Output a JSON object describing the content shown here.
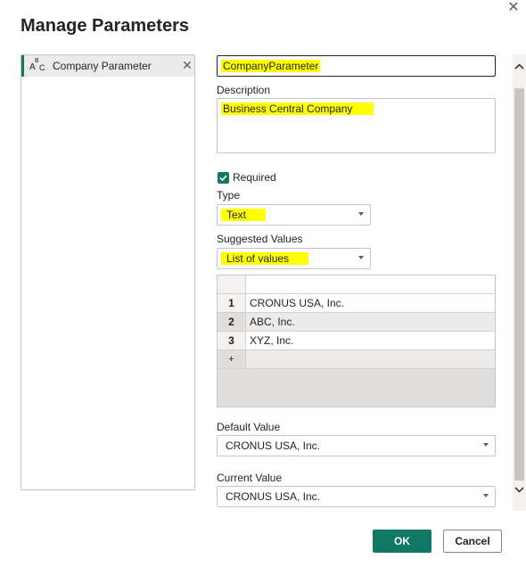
{
  "dialog": {
    "title": "Manage Parameters",
    "close_glyph": "✕"
  },
  "parameter_list": {
    "items": [
      {
        "type_icon": "abc-text-icon",
        "label": "Company Parameter",
        "remove_glyph": "✕"
      }
    ]
  },
  "form": {
    "name_value": "CompanyParameter",
    "description_label": "Description",
    "description_value": "Business Central Company",
    "required_label": "Required",
    "required_checked": true,
    "type_label": "Type",
    "type_value": "Text",
    "suggested_values_label": "Suggested Values",
    "suggested_values_value": "List of values",
    "values_table": {
      "rows": [
        {
          "num": "1",
          "value": "CRONUS USA, Inc."
        },
        {
          "num": "2",
          "value": "ABC, Inc."
        },
        {
          "num": "3",
          "value": "XYZ, Inc."
        }
      ],
      "add_row_glyph": "+"
    },
    "default_value_label": "Default Value",
    "default_value": "CRONUS USA, Inc.",
    "current_value_label": "Current Value",
    "current_value": "CRONUS USA, Inc."
  },
  "footer": {
    "ok_label": "OK",
    "cancel_label": "Cancel"
  },
  "colors": {
    "accent": "#117865",
    "highlight": "#ffff00"
  }
}
